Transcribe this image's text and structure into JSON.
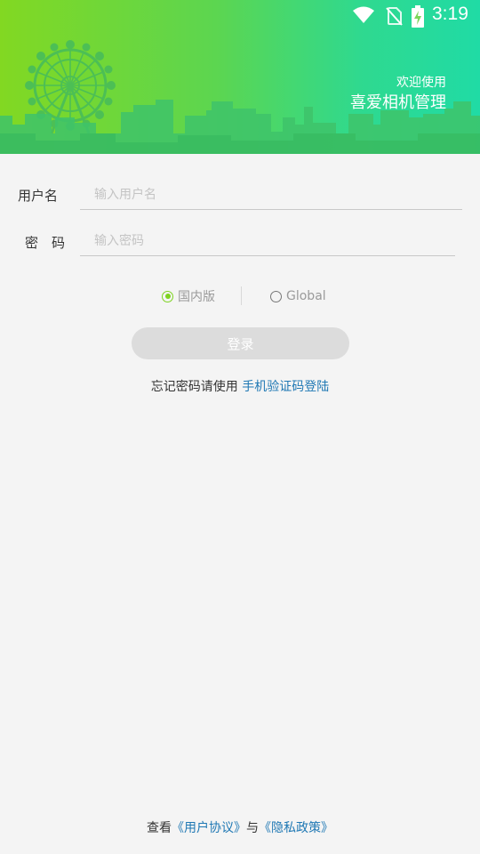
{
  "status_bar": {
    "time": "3:19",
    "icons": [
      "wifi-icon",
      "no-sim-icon",
      "battery-charging-icon"
    ]
  },
  "header": {
    "welcome": "欢迎使用",
    "app_name": "喜爱相机管理",
    "colors": {
      "gradient_start": "#82d822",
      "gradient_end": "#20dba5",
      "skyline": "#3ec36a"
    }
  },
  "form": {
    "username_label": "用户名",
    "username_placeholder": "输入用户名",
    "password_label": "密　码",
    "password_placeholder": "输入密码"
  },
  "region": {
    "options": [
      {
        "label": "国内版",
        "selected": true
      },
      {
        "label": "Global",
        "selected": false
      }
    ],
    "accent": "#7ed321"
  },
  "login_button": {
    "label": "登录"
  },
  "forgot": {
    "text": "忘记密码请使用",
    "link": "手机验证码登陆"
  },
  "footer": {
    "prefix": "查看",
    "user_agreement": "《用户协议》",
    "and": "与",
    "privacy_policy": "《隐私政策》"
  }
}
